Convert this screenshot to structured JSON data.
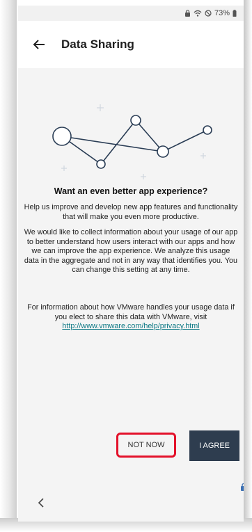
{
  "status_bar": {
    "battery": "73%",
    "icons": [
      "lock-icon",
      "wifi-icon",
      "do-not-disturb-icon",
      "battery-icon"
    ]
  },
  "header": {
    "title": "Data Sharing",
    "back_icon": "arrow-left-icon"
  },
  "main": {
    "heading": "Want an even better app experience?",
    "paragraph1": "Help us improve and develop new app features and functionality that will make you even more productive.",
    "paragraph2": "We would like to collect information about your usage of our app to better understand how users interact with our apps and how we can improve the app experience. We analyze this usage data in the aggregate and not in any way that identifies you. You can change this setting at any time.",
    "paragraph3": "For information about how VMware handles your usage data if you elect to share this data with VMware, visit",
    "privacy_link": "http://www.vmware.com/help/privacy.html"
  },
  "actions": {
    "not_now_label": "NOT NOW",
    "agree_label": "I AGREE"
  },
  "colors": {
    "agree_button": "#2e3d4f",
    "highlight": "#e3112a",
    "link": "#0f7a86"
  },
  "nav": {
    "back_icon": "chevron-left-icon"
  }
}
